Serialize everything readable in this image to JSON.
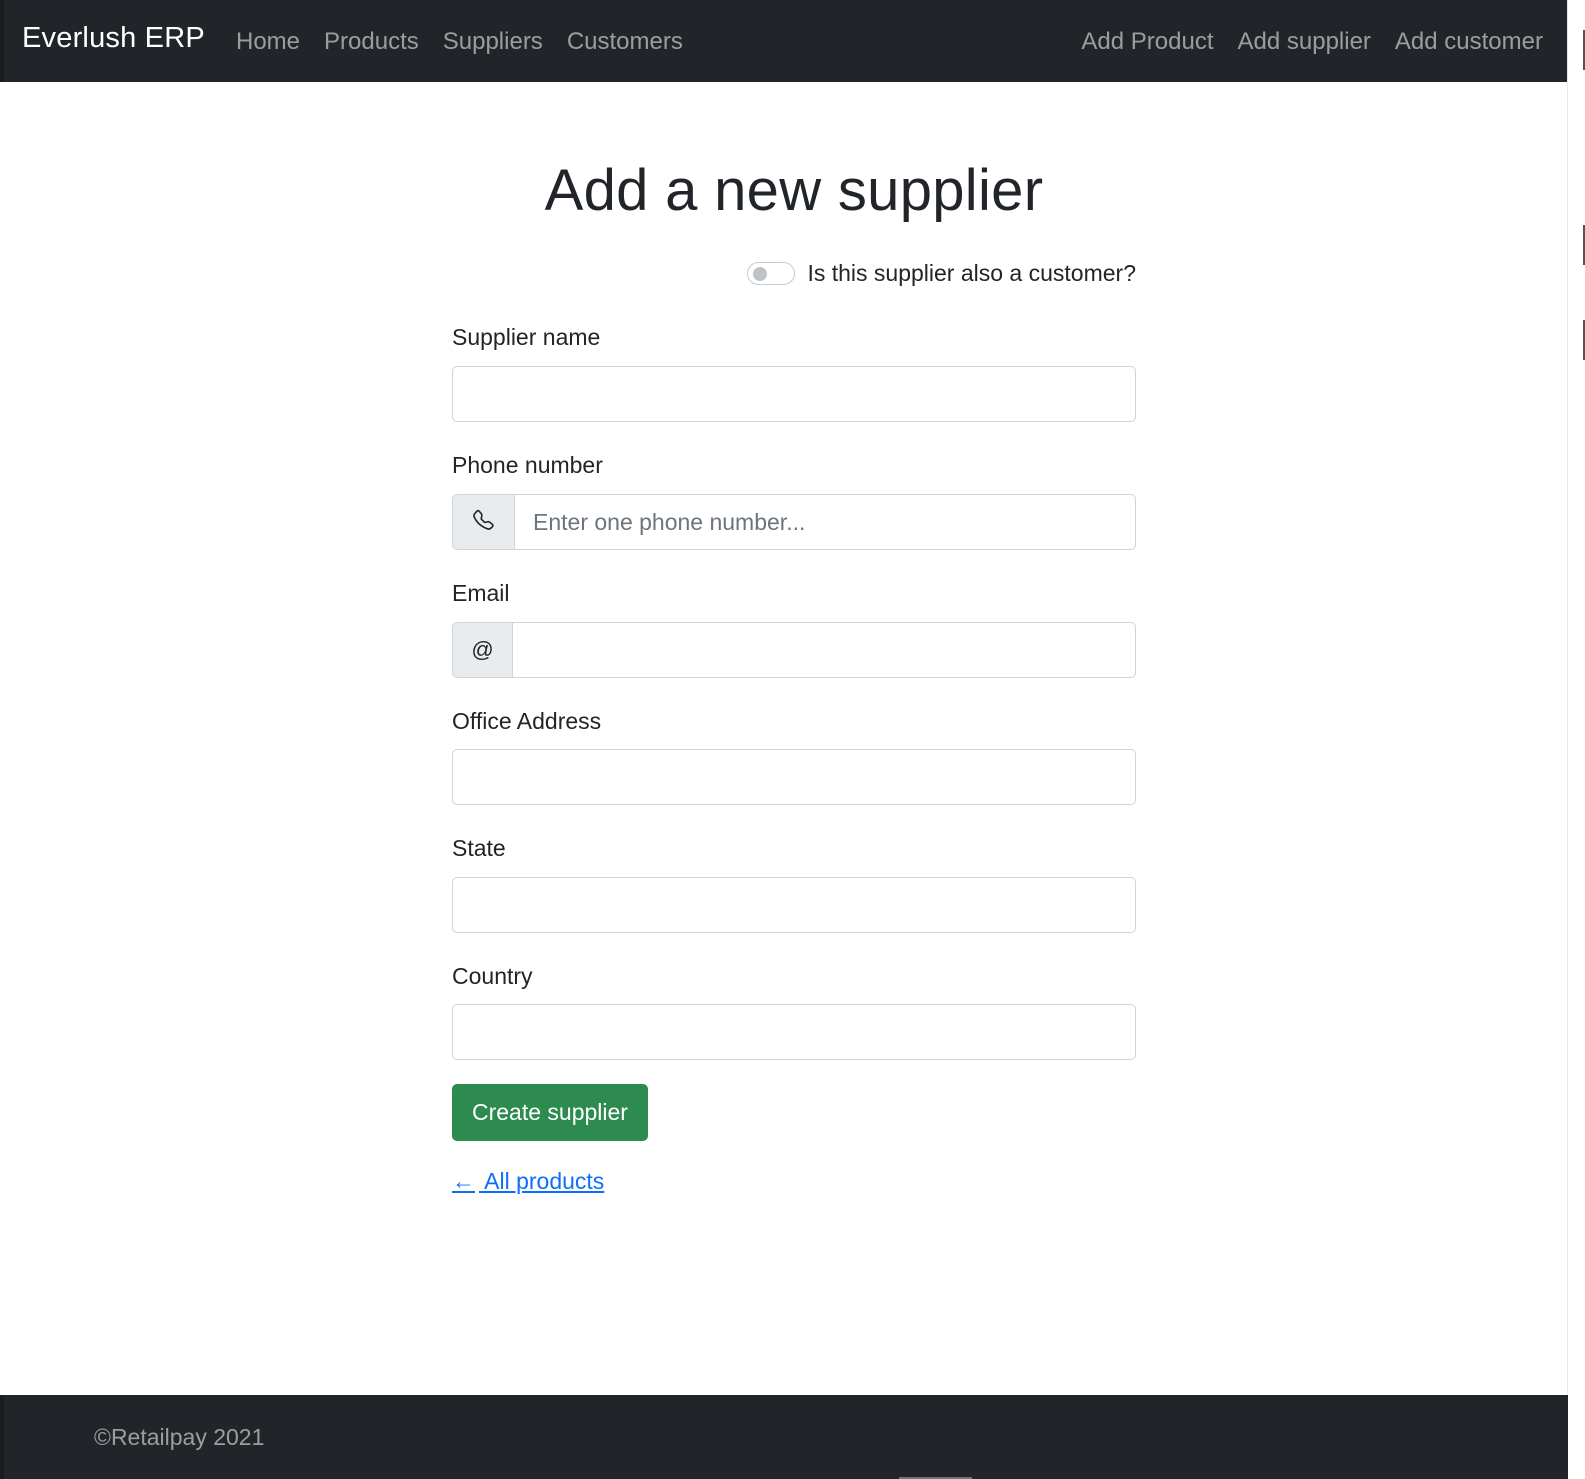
{
  "navbar": {
    "brand": "Everlush ERP",
    "left_links": [
      "Home",
      "Products",
      "Suppliers",
      "Customers"
    ],
    "right_links": [
      "Add Product",
      "Add supplier",
      "Add customer"
    ]
  },
  "form": {
    "title": "Add a new supplier",
    "customer_toggle_label": "Is this supplier also a customer?",
    "customer_toggle_on": false,
    "supplier_name_label": "Supplier name",
    "supplier_name_value": "",
    "phone_label": "Phone number",
    "phone_icon": "phone-icon",
    "phone_placeholder": "Enter one phone number...",
    "email_label": "Email",
    "email_addon": "@",
    "email_value": "",
    "office_address_label": "Office Address",
    "office_address_value": "",
    "state_label": "State",
    "state_value": "",
    "country_label": "Country",
    "country_value": "",
    "submit_label": "Create supplier",
    "back_arrow": "←",
    "back_label": " All products"
  },
  "footer": {
    "text": "©Retailpay 2021"
  },
  "colors": {
    "navbar_bg": "#212529",
    "primary_button": "#2e8b4f",
    "link": "#0d6efd"
  }
}
